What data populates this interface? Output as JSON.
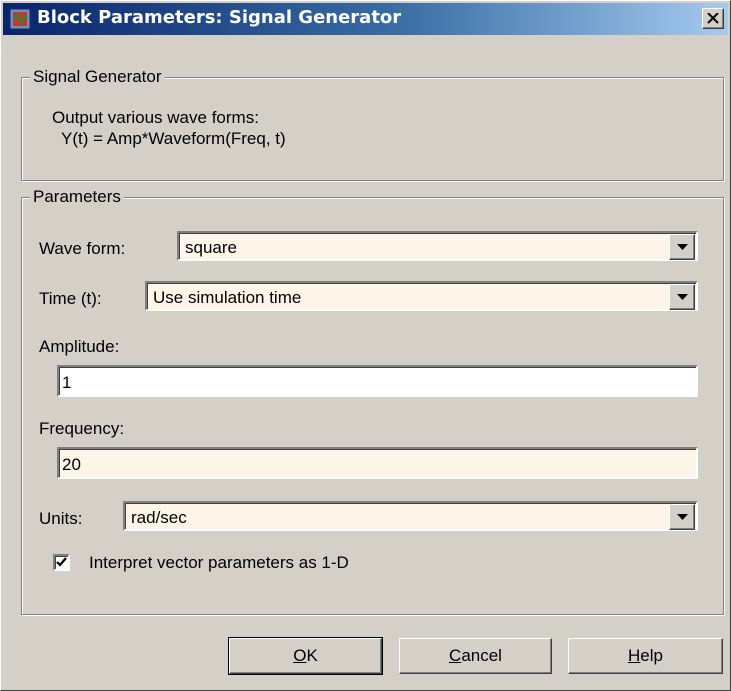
{
  "window": {
    "title": "Block Parameters: Signal Generator"
  },
  "description_group": {
    "legend": "Signal Generator",
    "line1": "Output various wave forms:",
    "line2": "Y(t) = Amp*Waveform(Freq, t)"
  },
  "parameters": {
    "legend": "Parameters",
    "wave_form": {
      "label": "Wave form:",
      "value": "square"
    },
    "time": {
      "label": "Time (t):",
      "value": "Use simulation time"
    },
    "amplitude": {
      "label": "Amplitude:",
      "value": "1"
    },
    "frequency": {
      "label": "Frequency:",
      "value": "20"
    },
    "units": {
      "label": "Units:",
      "value": "rad/sec"
    },
    "interpret_vector": {
      "label": "Interpret vector parameters as 1-D",
      "checked": true
    }
  },
  "buttons": {
    "ok": {
      "mnemonic": "O",
      "rest": "K"
    },
    "cancel": {
      "mnemonic": "C",
      "rest": "ancel"
    },
    "help": {
      "mnemonic": "H",
      "rest": "elp"
    }
  },
  "icons": [
    "simulink-block-icon",
    "close-icon",
    "dropdown-arrow-icon",
    "checkmark-icon"
  ],
  "colors": {
    "titlebar_start": "#0a246a",
    "titlebar_end": "#a6caf0",
    "dialog_bg": "#d4d0c8",
    "field_tint": "#fdf5e8"
  }
}
